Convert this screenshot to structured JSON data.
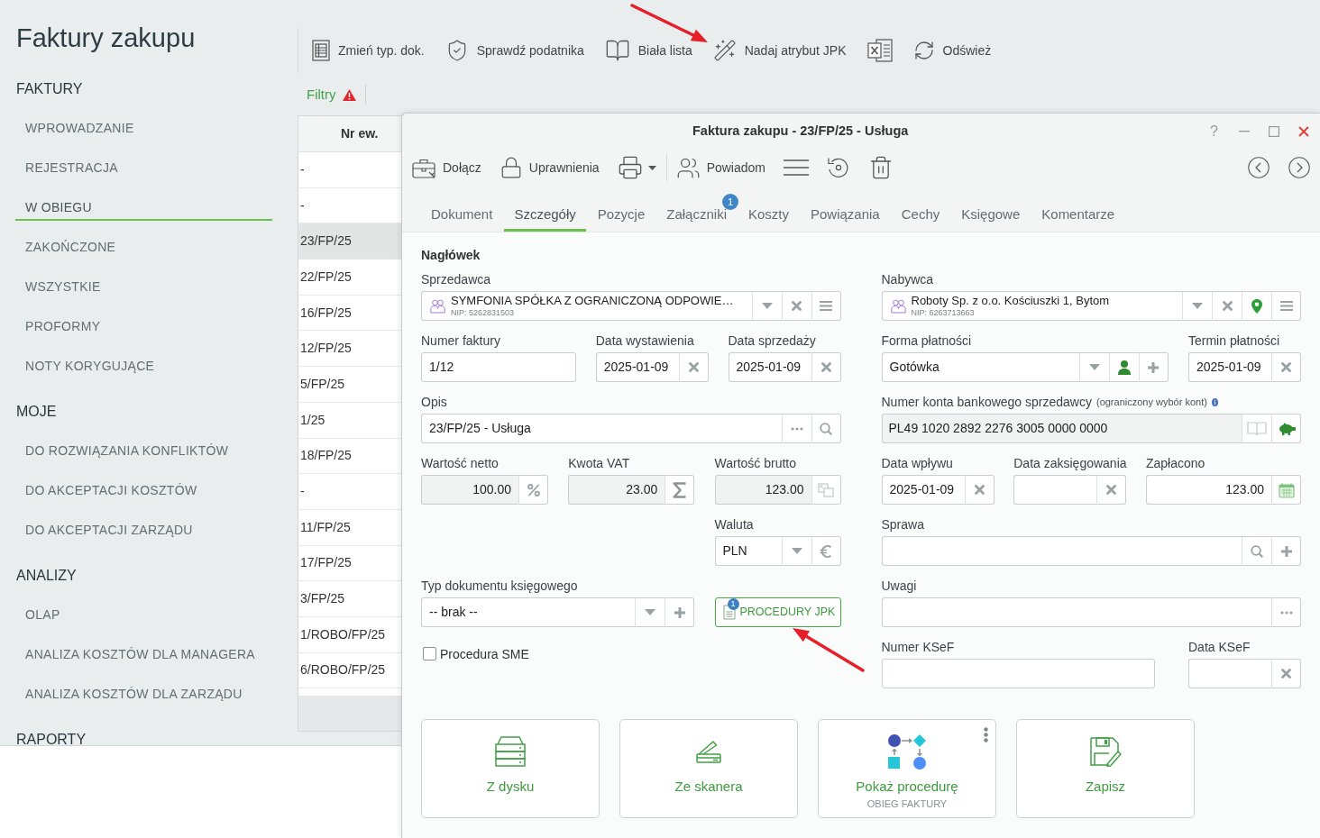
{
  "page": {
    "title": "Faktury zakupu"
  },
  "sidebar": {
    "sections": [
      {
        "heading": "FAKTURY",
        "items": [
          {
            "label": "WPROWADZANIE",
            "selected": false
          },
          {
            "label": "REJESTRACJA",
            "selected": false
          },
          {
            "label": "W OBIEGU",
            "selected": true
          },
          {
            "label": "ZAKOŃCZONE",
            "selected": false
          },
          {
            "label": "WSZYSTKIE",
            "selected": false
          },
          {
            "label": "PROFORMY",
            "selected": false
          },
          {
            "label": "NOTY KORYGUJĄCE",
            "selected": false
          }
        ]
      },
      {
        "heading": "MOJE",
        "items": [
          {
            "label": "DO ROZWIĄZANIA KONFLIKTÓW",
            "selected": false
          },
          {
            "label": "DO AKCEPTACJI KOSZTÓW",
            "selected": false
          },
          {
            "label": "DO AKCEPTACJI ZARZĄDU",
            "selected": false
          }
        ]
      },
      {
        "heading": "ANALIZY",
        "items": [
          {
            "label": "OLAP",
            "selected": false
          },
          {
            "label": "ANALIZA KOSZTÓW DLA MANAGERA",
            "selected": false
          },
          {
            "label": "ANALIZA KOSZTÓW DLA ZARZĄDU",
            "selected": false
          }
        ]
      },
      {
        "heading": "RAPORTY"
      }
    ]
  },
  "toolbar": [
    {
      "kind": "change-type",
      "label": "Zmień typ. dok."
    },
    {
      "kind": "verify",
      "label": "Sprawdź podatnika"
    },
    {
      "kind": "whitelist",
      "label": "Biała lista"
    },
    {
      "kind": "jpk",
      "label": "Nadaj atrybut JPK"
    },
    {
      "kind": "excel"
    },
    {
      "kind": "refresh",
      "label": "Odśwież"
    }
  ],
  "filters": {
    "label": "Filtry",
    "warning": true
  },
  "list": {
    "columns": [
      "Nr ew."
    ],
    "rows": [
      {
        "cells": [
          "-"
        ],
        "selected": false
      },
      {
        "cells": [
          "-"
        ],
        "selected": false
      },
      {
        "cells": [
          "23/FP/25"
        ],
        "selected": true
      },
      {
        "cells": [
          "22/FP/25"
        ],
        "selected": false
      },
      {
        "cells": [
          "16/FP/25"
        ],
        "selected": false
      },
      {
        "cells": [
          "12/FP/25"
        ],
        "selected": false
      },
      {
        "cells": [
          "5/FP/25"
        ],
        "selected": false
      },
      {
        "cells": [
          "1/25"
        ],
        "selected": false
      },
      {
        "cells": [
          "18/FP/25"
        ],
        "selected": false
      },
      {
        "cells": [
          "-"
        ],
        "selected": false
      },
      {
        "cells": [
          "11/FP/25"
        ],
        "selected": false
      },
      {
        "cells": [
          "17/FP/25"
        ],
        "selected": false
      },
      {
        "cells": [
          "3/FP/25"
        ],
        "selected": false
      },
      {
        "cells": [
          "1/ROBO/FP/25"
        ],
        "selected": false
      },
      {
        "cells": [
          "6/ROBO/FP/25"
        ],
        "selected": false
      }
    ]
  },
  "dialog": {
    "title": "Faktura zakupu - 23/FP/25 - Usługa",
    "help": "?",
    "toolbar": [
      {
        "kind": "attach",
        "label": "Dołącz"
      },
      {
        "kind": "permissions",
        "label": "Uprawnienia"
      },
      {
        "kind": "print"
      },
      {
        "kind": "notify",
        "label": "Powiadom"
      },
      {
        "kind": "menu"
      },
      {
        "kind": "restore"
      },
      {
        "kind": "delete"
      }
    ],
    "tabs": [
      {
        "label": "Dokument",
        "selected": false
      },
      {
        "label": "Szczegóły",
        "selected": true
      },
      {
        "label": "Pozycje",
        "selected": false
      },
      {
        "label": "Załączniki",
        "selected": false,
        "badge": "1"
      },
      {
        "label": "Koszty",
        "selected": false
      },
      {
        "label": "Powiązania",
        "selected": false
      },
      {
        "label": "Cechy",
        "selected": false
      },
      {
        "label": "Księgowe",
        "selected": false
      },
      {
        "label": "Komentarze",
        "selected": false
      }
    ],
    "form": {
      "heading": "Nagłówek",
      "seller": {
        "label": "Sprzedawca",
        "name": "SYMFONIA SPÓŁKA Z OGRANICZONĄ ODPOWIE…",
        "nip": "NIP: 5262831503"
      },
      "buyer": {
        "label": "Nabywca",
        "name": "Roboty Sp. z o.o. Kościuszki 1, Bytom",
        "nip": "NIP: 6263713663"
      },
      "invoice_number": {
        "label": "Numer faktury",
        "value": "1/12"
      },
      "issue_date": {
        "label": "Data wystawienia",
        "value": "2025-01-09"
      },
      "sale_date": {
        "label": "Data sprzedaży",
        "value": "2025-01-09"
      },
      "payment_method": {
        "label": "Forma płatności",
        "value": "Gotówka"
      },
      "payment_due": {
        "label": "Termin płatności",
        "value": "2025-01-09"
      },
      "description": {
        "label": "Opis",
        "value": "23/FP/25 - Usługa"
      },
      "bank_account": {
        "label": "Numer konta bankowego sprzedawcy",
        "note": "(ograniczony wybór kont)",
        "value": "PL49 1020 2892 2276 3005 0000 0000",
        "readonly": true
      },
      "net_value": {
        "label": "Wartość netto",
        "value": "100.00",
        "readonly": true
      },
      "vat_amount": {
        "label": "Kwota VAT",
        "value": "23.00",
        "readonly": true
      },
      "gross_value": {
        "label": "Wartość brutto",
        "value": "123.00",
        "readonly": true
      },
      "receipt_date": {
        "label": "Data wpływu",
        "value": "2025-01-09"
      },
      "posting_date": {
        "label": "Data zaksięgowania"
      },
      "paid": {
        "label": "Zapłacono",
        "value": "123.00"
      },
      "currency": {
        "label": "Waluta",
        "value": "PLN"
      },
      "case": {
        "label": "Sprawa"
      },
      "document_type": {
        "label": "Typ dokumentu księgowego",
        "value": "-- brak --"
      },
      "jpk_procedures": {
        "label": "PROCEDURY JPK",
        "badge": "1"
      },
      "remarks": {
        "label": "Uwagi"
      },
      "sme_procedure": {
        "label": "Procedura SME",
        "checked": false
      },
      "ksef_number": {
        "label": "Numer KSeF"
      },
      "ksef_date": {
        "label": "Data KSeF"
      }
    },
    "tiles": [
      {
        "kind": "disk",
        "label": "Z dysku"
      },
      {
        "kind": "scanner",
        "label": "Ze skanera"
      },
      {
        "kind": "procedure",
        "label": "Pokaż procedurę",
        "sublabel": "OBIEG FAKTURY"
      },
      {
        "kind": "save",
        "label": "Zapisz"
      }
    ]
  }
}
